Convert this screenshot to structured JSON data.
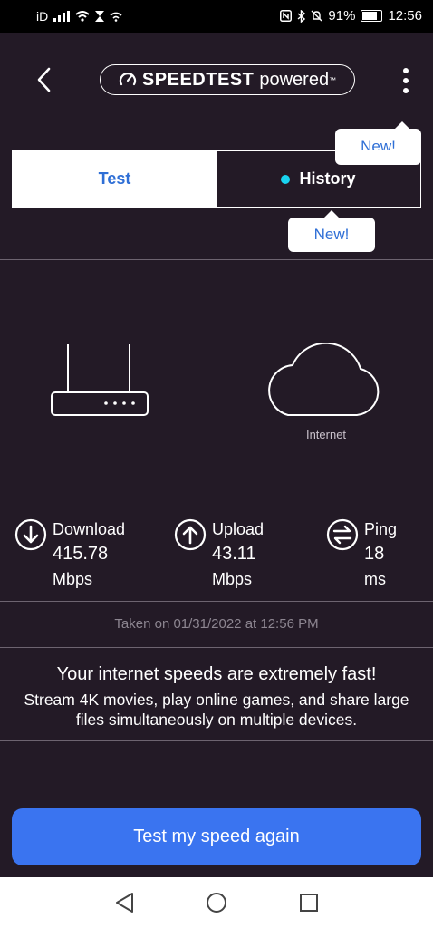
{
  "status_bar": {
    "left_text": "iD",
    "battery": "91%",
    "time": "12:56"
  },
  "header": {
    "logo_main": "SPEEDTEST",
    "logo_sub": "powered",
    "logo_tm": "™"
  },
  "tooltips": {
    "menu_new": "New!",
    "history_new": "New!"
  },
  "tabs": {
    "test": "Test",
    "history": "History",
    "accent": "#2f6fd6",
    "history_dot_color": "#19d3f0"
  },
  "diagram": {
    "internet_label": "Internet"
  },
  "results": {
    "download": {
      "label": "Download",
      "value": "415.78",
      "unit": "Mbps"
    },
    "upload": {
      "label": "Upload",
      "value": "43.11",
      "unit": "Mbps"
    },
    "ping": {
      "label": "Ping",
      "value": "18",
      "unit": "ms"
    }
  },
  "taken_on": "Taken on 01/31/2022 at 12:56 PM",
  "message": {
    "title": "Your internet speeds are extremely fast!",
    "body": "Stream 4K movies, play online games, and share large files simultaneously on multiple devices."
  },
  "cta": {
    "label": "Test my speed again",
    "color": "#3a74f0"
  },
  "icons": {
    "back": "chevron-left-icon",
    "menu": "more-vertical-icon",
    "download": "arrow-down-circle-icon",
    "upload": "arrow-up-circle-icon",
    "ping": "swap-circle-icon",
    "nav_back": "triangle-back-icon",
    "nav_home": "circle-home-icon",
    "nav_recents": "square-recents-icon"
  }
}
